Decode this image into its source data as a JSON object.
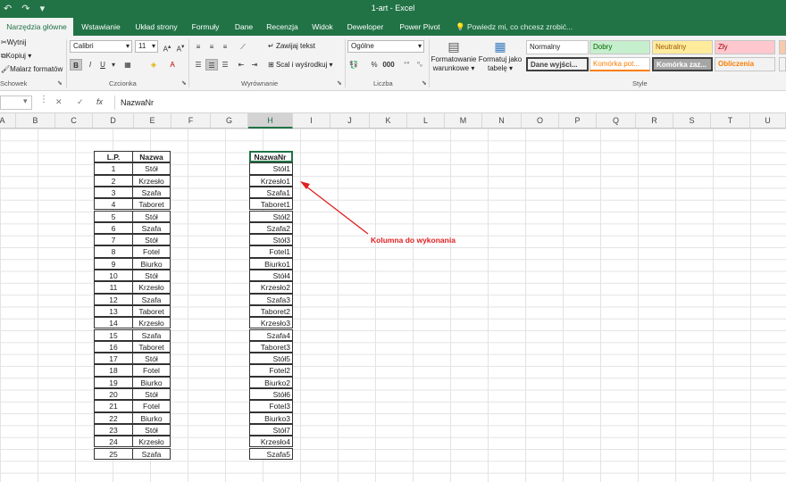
{
  "window": {
    "title": "1-art - Excel"
  },
  "quick_access": {
    "undo_icon": "↶",
    "redo_icon": "↷",
    "dropdown_icon": "▾"
  },
  "tabs": [
    "Narzędzia główne",
    "Wstawianie",
    "Układ strony",
    "Formuły",
    "Dane",
    "Recenzja",
    "Widok",
    "Deweloper",
    "Power Pivot"
  ],
  "tell_me": "Powiedz mi, co chcesz zrobić...",
  "ribbon": {
    "clipboard": {
      "cut": "Wytnij",
      "copy": "Kopiuj",
      "painter": "Malarz formatów",
      "label": "Schowek"
    },
    "font": {
      "name": "Calibri",
      "size": "11",
      "label": "Czcionka",
      "bold": "B",
      "italic": "I",
      "underline": "U"
    },
    "alignment": {
      "wrap": "Zawijaj tekst",
      "merge": "Scal i wyśrodkuj",
      "label": "Wyrównanie"
    },
    "number": {
      "format": "Ogólne",
      "label": "Liczba"
    },
    "styles": {
      "conditional": [
        "Formatowanie",
        "warunkowe"
      ],
      "as_table": [
        "Formatuj jako",
        "tabelę"
      ],
      "label": "Style",
      "cells": [
        {
          "text": "Normalny",
          "bg": "#ffffff",
          "fg": "#222222"
        },
        {
          "text": "Dobry",
          "bg": "#c6efce",
          "fg": "#006100"
        },
        {
          "text": "Neutralny",
          "bg": "#ffeb9c",
          "fg": "#9c5700"
        },
        {
          "text": "Zły",
          "bg": "#ffc7ce",
          "fg": "#9c0006"
        },
        {
          "text": "Dane wyjści...",
          "bg": "#f2f2f2",
          "fg": "#3f3f3f"
        },
        {
          "text": "Komórka pot...",
          "bg": "#ffffff",
          "fg": "#fa7d00"
        },
        {
          "text": "Komórka zaz...",
          "bg": "#a5a5a5",
          "fg": "#ffffff"
        },
        {
          "text": "Obliczenia",
          "bg": "#f2f2f2",
          "fg": "#fa7d00"
        }
      ]
    }
  },
  "formula_bar": {
    "name_box": "",
    "cancel": "✕",
    "enter": "✓",
    "fx": "fx",
    "formula": "NazwaNr"
  },
  "columns": [
    "A",
    "B",
    "C",
    "D",
    "E",
    "F",
    "G",
    "H",
    "I",
    "J",
    "K",
    "L",
    "M",
    "N",
    "O",
    "P",
    "Q",
    "R",
    "S",
    "T",
    "U"
  ],
  "selected_column": "H",
  "table1": {
    "headers": [
      "L.P.",
      "Nazwa"
    ],
    "rows": [
      [
        "1",
        "Stół"
      ],
      [
        "2",
        "Krzesło"
      ],
      [
        "3",
        "Szafa"
      ],
      [
        "4",
        "Taboret"
      ],
      [
        "5",
        "Stół"
      ],
      [
        "6",
        "Szafa"
      ],
      [
        "7",
        "Stół"
      ],
      [
        "8",
        "Fotel"
      ],
      [
        "9",
        "Biurko"
      ],
      [
        "10",
        "Stół"
      ],
      [
        "11",
        "Krzesło"
      ],
      [
        "12",
        "Szafa"
      ],
      [
        "13",
        "Taboret"
      ],
      [
        "14",
        "Krzesło"
      ],
      [
        "15",
        "Szafa"
      ],
      [
        "16",
        "Taboret"
      ],
      [
        "17",
        "Stół"
      ],
      [
        "18",
        "Fotel"
      ],
      [
        "19",
        "Biurko"
      ],
      [
        "20",
        "Stół"
      ],
      [
        "21",
        "Fotel"
      ],
      [
        "22",
        "Biurko"
      ],
      [
        "23",
        "Stół"
      ],
      [
        "24",
        "Krzesło"
      ],
      [
        "25",
        "Szafa"
      ]
    ]
  },
  "table2": {
    "header": "NazwaNr",
    "rows": [
      "Stół1",
      "Krzesło1",
      "Szafa1",
      "Taboret1",
      "Stół2",
      "Szafa2",
      "Stół3",
      "Fotel1",
      "Biurko1",
      "Stół4",
      "Krzesło2",
      "Szafa3",
      "Taboret2",
      "Krzesło3",
      "Szafa4",
      "Taboret3",
      "Stół5",
      "Fotel2",
      "Biurko2",
      "Stół6",
      "Fotel3",
      "Biurko3",
      "Stół7",
      "Krzesło4",
      "Szafa5"
    ]
  },
  "annotation": {
    "text": "Kolumna do wykonania",
    "color": "#e02020"
  }
}
